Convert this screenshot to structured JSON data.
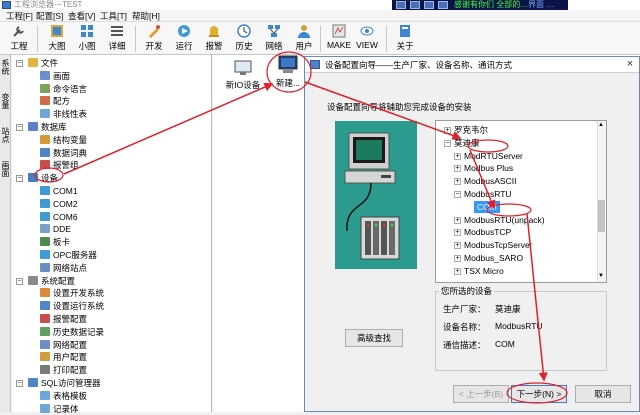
{
  "window": {
    "title": "工程浏览器---TEST"
  },
  "banner": {
    "text1": "感谢有你们 全部的…",
    "text2": "界面 …"
  },
  "menu": [
    "工程[F]",
    "配置[S]",
    "查看[V]",
    "工具[T]",
    "帮助[H]"
  ],
  "toolbar": [
    {
      "label": "工程",
      "icon": "wrench-icon"
    },
    {
      "label": "大图",
      "icon": "large-icons-icon"
    },
    {
      "label": "小图",
      "icon": "small-icons-icon"
    },
    {
      "label": "详细",
      "icon": "details-icon"
    },
    {
      "label": "开发",
      "icon": "develop-icon"
    },
    {
      "label": "运行",
      "icon": "run-icon"
    },
    {
      "label": "报警",
      "icon": "alarm-icon"
    },
    {
      "label": "历史",
      "icon": "history-icon"
    },
    {
      "label": "网络",
      "icon": "network-icon"
    },
    {
      "label": "用户",
      "icon": "user-icon"
    },
    {
      "label": "MAKE",
      "icon": "make-icon"
    },
    {
      "label": "VIEW",
      "icon": "view-icon"
    },
    {
      "label": "关于",
      "icon": "about-icon"
    }
  ],
  "sidetabs": [
    "系统",
    "变量",
    "站点",
    "画面"
  ],
  "tree": {
    "items": [
      {
        "label": "文件",
        "level": 0,
        "color": "#e3b33f"
      },
      {
        "label": "画面",
        "level": 1,
        "color": "#6c8fd0"
      },
      {
        "label": "命令语言",
        "level": 1,
        "color": "#7ba659"
      },
      {
        "label": "配方",
        "level": 1,
        "color": "#cf6c49"
      },
      {
        "label": "非线性表",
        "level": 1,
        "color": "#6fa6d8"
      },
      {
        "label": "数据库",
        "level": 0,
        "color": "#5a82c9"
      },
      {
        "label": "结构变量",
        "level": 1,
        "color": "#d49a37"
      },
      {
        "label": "数据词典",
        "level": 1,
        "color": "#4f86c6"
      },
      {
        "label": "报警组",
        "level": 1,
        "color": "#c94f4f"
      },
      {
        "label": "设备",
        "level": 0,
        "color": "#4a7dc0"
      },
      {
        "label": "COM1",
        "level": 1,
        "color": "#3f9ad6"
      },
      {
        "label": "COM2",
        "level": 1,
        "color": "#3f9ad6"
      },
      {
        "label": "COM6",
        "level": 1,
        "color": "#3f9ad6"
      },
      {
        "label": "DDE",
        "level": 1,
        "color": "#7aa0c8"
      },
      {
        "label": "板卡",
        "level": 1,
        "color": "#4d8c4d"
      },
      {
        "label": "OPC服务器",
        "level": 1,
        "color": "#3f9ad6"
      },
      {
        "label": "网络站点",
        "level": 1,
        "color": "#6b8fc3"
      },
      {
        "label": "系统配置",
        "level": 0,
        "color": "#8a8a8a"
      },
      {
        "label": "设置开发系统",
        "level": 1,
        "color": "#d98b3a"
      },
      {
        "label": "设置运行系统",
        "level": 1,
        "color": "#4f86c6"
      },
      {
        "label": "报警配置",
        "level": 1,
        "color": "#c94f4f"
      },
      {
        "label": "历史数据记录",
        "level": 1,
        "color": "#5f9f5f"
      },
      {
        "label": "网络配置",
        "level": 1,
        "color": "#6b8fc3"
      },
      {
        "label": "用户配置",
        "level": 1,
        "color": "#d0a040"
      },
      {
        "label": "打印配置",
        "level": 1,
        "color": "#7a7a7a"
      },
      {
        "label": "SQL访问管理器",
        "level": 0,
        "color": "#4f86c6"
      },
      {
        "label": "表格模板",
        "level": 1,
        "color": "#6fa6d8"
      },
      {
        "label": "记录体",
        "level": 1,
        "color": "#6fa6d8"
      }
    ]
  },
  "right_pane": {
    "new_io_label": "新IO设备",
    "new_label": "新建..."
  },
  "dialog": {
    "title": "设备配置向导——生产厂家、设备名称、通讯方式",
    "description": "设备配置向导将辅助您完成设备的安装",
    "tree": [
      {
        "label": "罗克韦尔",
        "level": 0,
        "exp": "+"
      },
      {
        "label": "莫迪康",
        "level": 0,
        "exp": "-"
      },
      {
        "label": "ModRTUServer",
        "level": 1,
        "exp": "+"
      },
      {
        "label": "Modbus Plus",
        "level": 1,
        "exp": "+"
      },
      {
        "label": "ModbusASCII",
        "level": 1,
        "exp": "+"
      },
      {
        "label": "ModbusRTU",
        "level": 1,
        "exp": "-"
      },
      {
        "label": "COM",
        "level": 2,
        "exp": "",
        "selected": true
      },
      {
        "label": "ModbusRTU(unpack)",
        "level": 1,
        "exp": "+"
      },
      {
        "label": "ModbusTCP",
        "level": 1,
        "exp": "+"
      },
      {
        "label": "ModbusTcpServer",
        "level": 1,
        "exp": "+"
      },
      {
        "label": "Modbus_SARO",
        "level": 1,
        "exp": "+"
      },
      {
        "label": "TSX Micro",
        "level": 1,
        "exp": "+"
      }
    ],
    "selected_group": {
      "title": "您所选的设备",
      "manufacturer_label": "生产厂家：",
      "manufacturer": "莫迪康",
      "device_label": "设备名称：",
      "device": "ModbusRTU",
      "comm_label": "通信描述：",
      "comm": "COM"
    },
    "advanced_button": "高级查找",
    "back_button": "< 上一步(B)",
    "next_button": "下一步(N) >",
    "cancel_button": "取消"
  },
  "colors": {
    "annotation": "#e0202a",
    "selection": "#3399ff"
  }
}
